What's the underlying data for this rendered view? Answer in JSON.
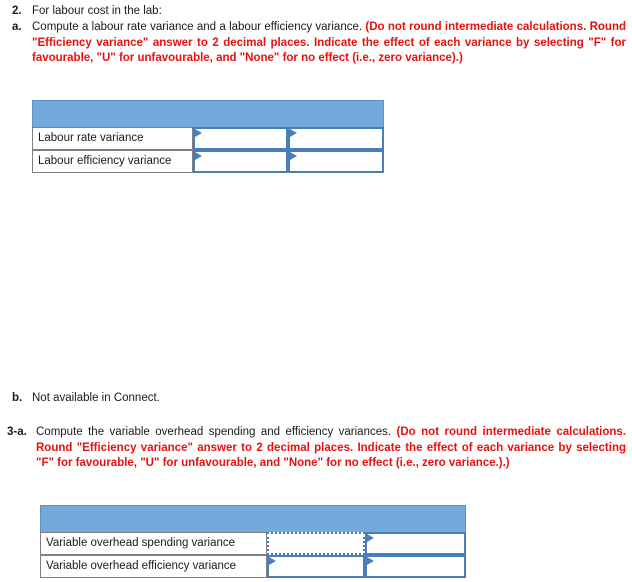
{
  "questions": [
    {
      "marker": "2.",
      "text_plain": "For labour cost in the lab:",
      "text_red": ""
    },
    {
      "marker": "a.",
      "text_plain": "Compute a labour rate variance and a labour efficiency variance. ",
      "text_red": "(Do not round intermediate calculations. Round \"Efficiency variance\" answer to 2 decimal places. Indicate the effect of each variance by selecting \"F\" for favourable, \"U\" for unfavourable, and \"None\" for no effect (i.e., zero variance).)"
    },
    {
      "marker": "b.",
      "text_plain": "Not available in Connect.",
      "text_red": ""
    },
    {
      "marker": "3-a.",
      "text_plain": "Compute the variable overhead spending and efficiency variances. ",
      "text_red": "(Do not round intermediate calculations. Round \"Efficiency variance\" answer to 2 decimal places. Indicate the effect of each variance by selecting \"F\" for favourable, \"U\" for unfavourable, and \"None\" for no effect (i.e., zero variance.).)"
    }
  ],
  "tables": {
    "labour": {
      "header_label": "",
      "rows": [
        {
          "label": "Labour rate variance",
          "value": "",
          "effect": ""
        },
        {
          "label": "Labour efficiency variance",
          "value": "",
          "effect": ""
        }
      ]
    },
    "variable_overhead": {
      "header_label": "",
      "rows": [
        {
          "label": "Variable overhead spending variance",
          "value": "",
          "effect": ""
        },
        {
          "label": "Variable overhead efficiency variance",
          "value": "",
          "effect": ""
        }
      ]
    }
  },
  "colors": {
    "header_blue": "#74a9dc",
    "input_border_blue": "#4a7ebb",
    "instruction_red": "#e8110f",
    "label_border_gray": "#808080"
  }
}
